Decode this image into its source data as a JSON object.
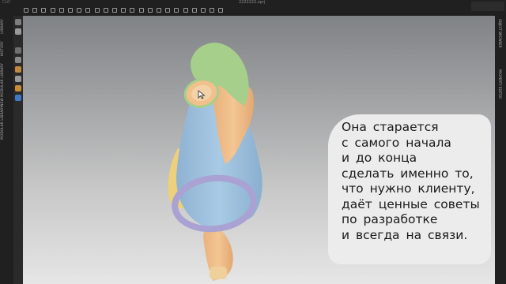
{
  "window": {
    "file_title": "2222222.zprj",
    "version": "CLO"
  },
  "toolbar": {
    "icons": [
      "select-icon",
      "move-icon",
      "rotate-icon",
      "sew-icon",
      "pin-icon",
      "segment-icon",
      "edit-curve-icon",
      "fold-icon",
      "seam-icon",
      "tack-icon",
      "layer-icon",
      "grid-icon",
      "texture-icon",
      "fabric-icon",
      "button-icon",
      "zipper-icon",
      "measure-icon",
      "camera-icon",
      "render-icon",
      "avatar-icon",
      "simulate-icon",
      "settings-icon",
      "record-icon"
    ]
  },
  "left_tabs": [
    "LIBRARY",
    "HISTORY",
    "NEW MODULAR LIBRARY",
    "MODULAR LIBRARY"
  ],
  "right_tabs": [
    "OBJECT BROWSER",
    "PROPERTY EDITOR"
  ],
  "caption": {
    "lines": [
      "Она старается",
      "с самого начала",
      "и до конца",
      "сделать именно то,",
      "что нужно клиенту,",
      "даёт ценные советы",
      "по разработке",
      "и всегда на связи."
    ]
  },
  "colors": {
    "collar_green": "#a5cf8b",
    "body_blue": "#a3c6e2",
    "accent_orange": "#f1c08c",
    "cuff_purple": "#a9a2d3",
    "panel_yellow": "#ecd07b"
  }
}
